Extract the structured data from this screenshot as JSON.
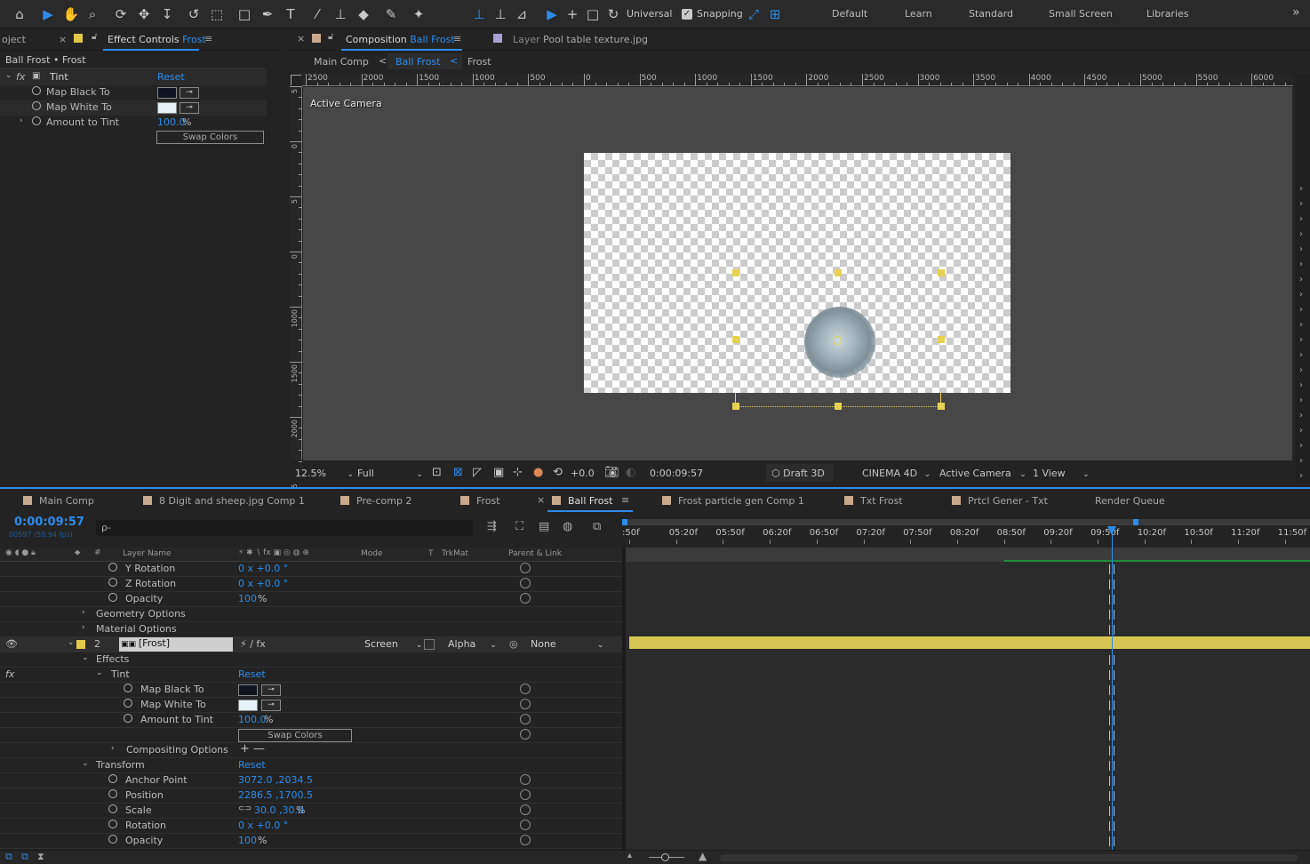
{
  "toolbar": {
    "tools": [
      "home-icon",
      "selection-icon",
      "hand-icon",
      "zoom-icon",
      "orbit-camera-icon",
      "pan-camera-icon",
      "dolly-camera-icon",
      "rotate-icon",
      "pan-behind-icon",
      "rectangle-icon",
      "pen-icon",
      "type-icon",
      "brush-icon",
      "clone-stamp-icon",
      "eraser-icon",
      "roto-brush-icon",
      "puppet-pin-icon"
    ],
    "axis_mode_label": "Universal",
    "snapping_label": "Snapping",
    "snapping_checked": true,
    "workspaces": [
      "Default",
      "Learn",
      "Standard",
      "Small Screen",
      "Libraries"
    ],
    "more_label": "»"
  },
  "effect_controls": {
    "project_tab": "oject",
    "close_glyph": "×",
    "tab_title": "Effect Controls",
    "tab_layer": "Frost",
    "breadcrumb": "Ball Frost • Frost",
    "effect_name": "Tint",
    "reset_label": "Reset",
    "props": [
      {
        "label": "Map Black To",
        "swatch": "#0e1520"
      },
      {
        "label": "Map White To",
        "swatch": "#e6f2f8"
      },
      {
        "label": "Amount to Tint",
        "value": "100.0",
        "unit": "%"
      }
    ],
    "swap_label": "Swap Colors"
  },
  "composition": {
    "tab_title": "Composition",
    "tab_comp": "Ball Frost",
    "layer_tab_prefix": "Layer",
    "layer_tab": "Pool table texture.jpg",
    "flow": [
      "Main Comp",
      "Ball Frost",
      "Frost"
    ],
    "flow_sep": "<",
    "ruler_labels": [
      "2500",
      "2000",
      "1500",
      "1000",
      "500",
      "0",
      "500",
      "1000",
      "1500",
      "2000",
      "2500",
      "3000",
      "3500",
      "4000",
      "4500",
      "5000",
      "5500",
      "6000"
    ],
    "vruler_labels": [
      "5",
      "0",
      "5",
      "0",
      "1000",
      "1500",
      "2000",
      "2500"
    ],
    "camera_label": "Active Camera",
    "footer": {
      "zoom": "12.5%",
      "resolution": "Full",
      "exposure": "+0.0",
      "timecode": "0:00:09:57",
      "draft3d": "Draft 3D",
      "renderer": "CINEMA 4D",
      "camera": "Active Camera",
      "views": "1 View"
    }
  },
  "timeline": {
    "tabs": [
      "Main Comp",
      "8 Digit and sheep.jpg Comp 1",
      "Pre-comp 2",
      "Frost",
      "Ball Frost",
      "Frost particle gen Comp 1",
      "Txt Frost",
      "Prtcl Gener - Txt",
      "Render Queue"
    ],
    "tab_colors": [
      "#c9a98d",
      "#c9a98d",
      "#c9a98d",
      "#c9a98d",
      "#c9a98d",
      "#c9a98d",
      "#c9a98d",
      "#c9a98d",
      ""
    ],
    "active_tab": "Ball Frost",
    "close_glyph": "×",
    "menu_glyph": "≡",
    "timecode": "0:00:09:57",
    "frames": "00597 (59.94 fps)",
    "search_glyph": "ρ-",
    "time_labels": [
      ":50f",
      "05:20f",
      "05:50f",
      "06:20f",
      "06:50f",
      "07:20f",
      "07:50f",
      "08:20f",
      "08:50f",
      "09:20f",
      "09:50f",
      "10:20f",
      "10:50f",
      "11:20f",
      "11:50f"
    ],
    "col_headers": {
      "layer_name": "Layer Name",
      "mode": "Mode",
      "t": "T",
      "trkmat": "TrkMat",
      "parent": "Parent & Link",
      "hash": "#"
    },
    "rows": [
      {
        "label": "Y Rotation",
        "value": "0 x +0.0 °"
      },
      {
        "label": "Z Rotation",
        "value": "0 x +0.0 °"
      },
      {
        "label": "Opacity",
        "value": "100",
        "unit": "%"
      },
      {
        "label": "Geometry Options"
      },
      {
        "label": "Material Options"
      },
      {
        "label": "[Frost]",
        "num": "2",
        "mode": "Screen",
        "trkmat": "Alpha",
        "parent": "None"
      },
      {
        "label": "Effects"
      },
      {
        "label": "Tint",
        "value": "Reset"
      },
      {
        "label": "Map Black To"
      },
      {
        "label": "Map White To"
      },
      {
        "label": "Amount to Tint",
        "value": "100.0",
        "unit": "%"
      },
      {
        "label": "",
        "value": "Swap Colors"
      },
      {
        "label": "Compositing Options",
        "value": "+ —"
      },
      {
        "label": "Transform",
        "value": "Reset"
      },
      {
        "label": "Anchor Point",
        "value": "3072.0 ,2034.5"
      },
      {
        "label": "Position",
        "value": "2286.5 ,1700.5"
      },
      {
        "label": "Scale",
        "value": "30.0 ,30.0",
        "unit": "%"
      },
      {
        "label": "Rotation",
        "value": "0 x +0.0 °"
      },
      {
        "label": "Opacity",
        "value": "100",
        "unit": "%"
      }
    ],
    "fx_badge": "fx",
    "playhead_fraction": 0.71,
    "colors": {
      "accent": "#2d8ceb",
      "layer_bar": "#d6c553",
      "label_yellow": "#e0c94a",
      "work_area": "#1b8f3a"
    }
  }
}
